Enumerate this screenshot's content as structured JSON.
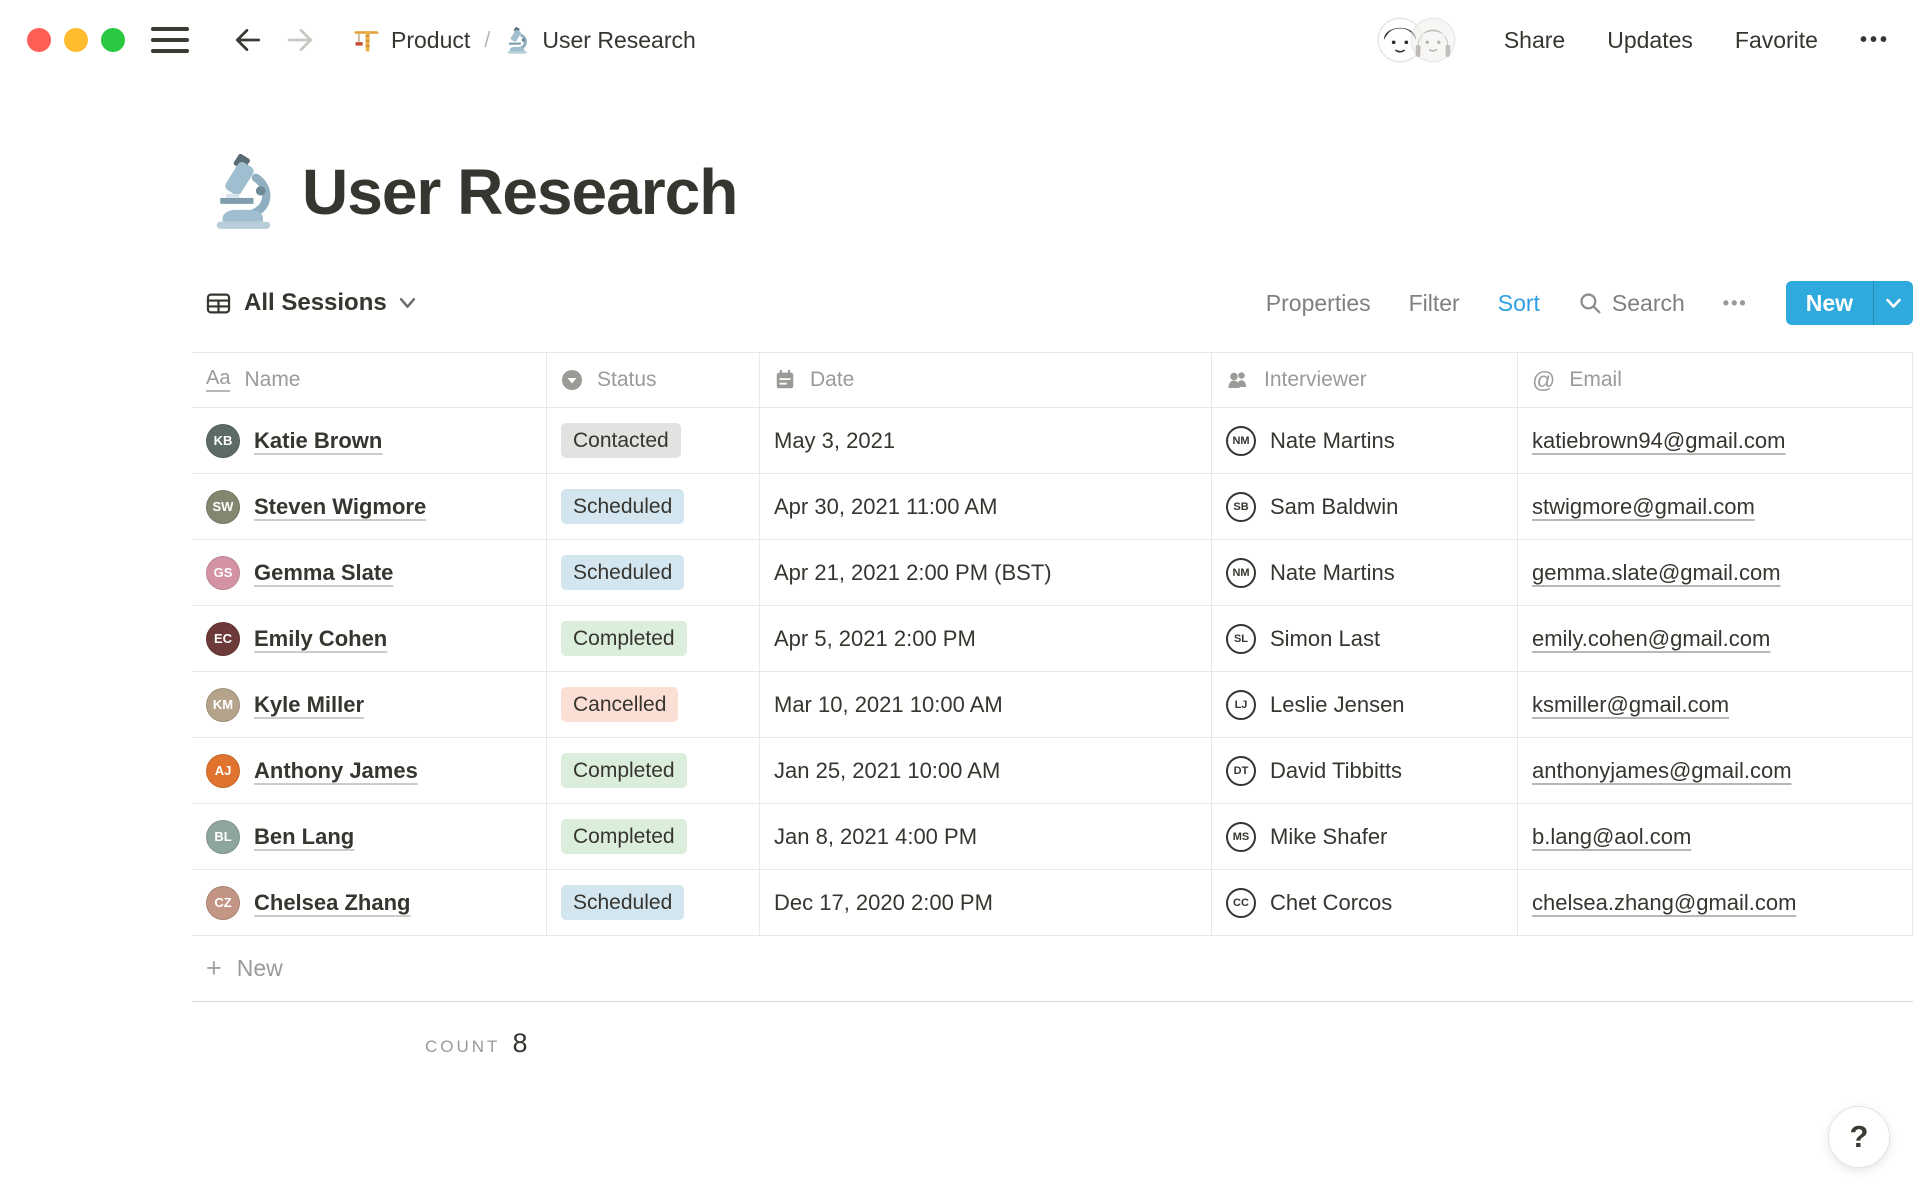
{
  "topbar": {
    "breadcrumb": {
      "items": [
        {
          "icon": "crane-icon",
          "label": "Product"
        },
        {
          "icon": "microscope-icon",
          "label": "User Research"
        }
      ],
      "separator": "/"
    },
    "actions": {
      "share": "Share",
      "updates": "Updates",
      "favorite": "Favorite",
      "more": "•••"
    }
  },
  "page": {
    "icon": "microscope-icon",
    "title": "User Research"
  },
  "view_toolbar": {
    "view_name": "All Sessions",
    "properties": "Properties",
    "filter": "Filter",
    "sort": "Sort",
    "search": "Search",
    "more": "•••",
    "new_button": "New"
  },
  "table": {
    "columns": [
      {
        "label": "Name",
        "icon": "title-icon",
        "glyph": "Aa"
      },
      {
        "label": "Status",
        "icon": "select-icon"
      },
      {
        "label": "Date",
        "icon": "calendar-icon"
      },
      {
        "label": "Interviewer",
        "icon": "person-icon"
      },
      {
        "label": "Email",
        "icon": "email-icon",
        "glyph": "@"
      }
    ],
    "rows": [
      {
        "name": "Katie Brown",
        "avatar_color": "#5c6b63",
        "status": "Contacted",
        "status_color": "gray",
        "date": "May 3, 2021",
        "interviewer": "Nate Martins",
        "email": "katiebrown94@gmail.com"
      },
      {
        "name": "Steven Wigmore",
        "avatar_color": "#84876f",
        "status": "Scheduled",
        "status_color": "blue",
        "date": "Apr 30, 2021 11:00 AM",
        "interviewer": "Sam Baldwin",
        "email": "stwigmore@gmail.com"
      },
      {
        "name": "Gemma Slate",
        "avatar_color": "#d493a5",
        "status": "Scheduled",
        "status_color": "blue",
        "date": "Apr 21, 2021 2:00 PM (BST)",
        "interviewer": "Nate Martins",
        "email": "gemma.slate@gmail.com"
      },
      {
        "name": "Emily Cohen",
        "avatar_color": "#6d3a3a",
        "status": "Completed",
        "status_color": "green",
        "date": "Apr 5, 2021 2:00 PM",
        "interviewer": "Simon Last",
        "email": "emily.cohen@gmail.com"
      },
      {
        "name": "Kyle Miller",
        "avatar_color": "#b5a38c",
        "status": "Cancelled",
        "status_color": "red",
        "date": "Mar 10, 2021 10:00 AM",
        "interviewer": "Leslie Jensen",
        "email": "ksmiller@gmail.com"
      },
      {
        "name": "Anthony James",
        "avatar_color": "#e0742f",
        "status": "Completed",
        "status_color": "green",
        "date": "Jan 25, 2021 10:00 AM",
        "interviewer": "David Tibbitts",
        "email": "anthonyjames@gmail.com"
      },
      {
        "name": "Ben Lang",
        "avatar_color": "#8fa5a0",
        "status": "Completed",
        "status_color": "green",
        "date": "Jan 8, 2021 4:00 PM",
        "interviewer": "Mike Shafer",
        "email": "b.lang@aol.com"
      },
      {
        "name": "Chelsea Zhang",
        "avatar_color": "#c29584",
        "status": "Scheduled",
        "status_color": "blue",
        "date": "Dec 17, 2020 2:00 PM",
        "interviewer": "Chet Corcos",
        "email": "chelsea.zhang@gmail.com"
      }
    ],
    "new_row_label": "New",
    "count_label": "COUNT",
    "count_value": "8"
  },
  "help_button": "?",
  "colors": {
    "accent_blue": "#2eaadc",
    "sort_active_blue": "#2e9fe3",
    "pill_gray": "#e3e2e0",
    "pill_blue": "#d3e5ef",
    "pill_green": "#dbeddb",
    "pill_red": "#fbded4",
    "traffic_red": "#ff5f57",
    "traffic_yellow": "#febc2e",
    "traffic_green": "#28c840"
  }
}
